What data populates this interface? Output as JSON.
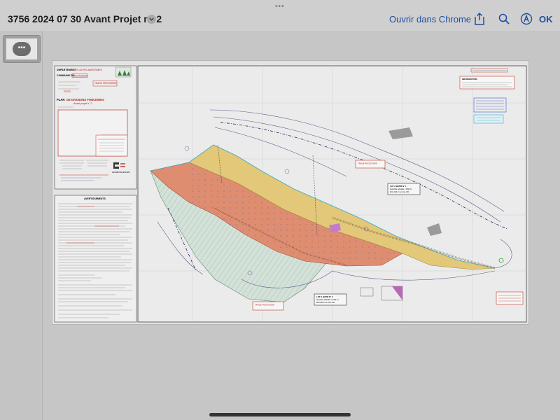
{
  "toolbar": {
    "title": "3756 2024 07 30 Avant Projet n° 2",
    "open_in_chrome": "Ouvrir dans Chrome",
    "ok": "OK",
    "grabber": "•••",
    "icons": [
      "chevron-down-icon",
      "share-icon",
      "search-icon",
      "markup-icon"
    ]
  },
  "sidebar": {
    "thumb_more": "•••"
  },
  "document": {
    "cartouche": {
      "dept_label": "DEPARTEMENT",
      "dept_value": "DES ALPES-MARITIMES",
      "commune_label": "COMMUNE DE",
      "commune_value": "BELVEDERE",
      "stamp": "TRAGE PROVISOIRE",
      "plan_label": "PLAN",
      "plan_title": "DE DIVISIONS FONCIERES",
      "plan_subtitle": "Avant projet n° 2",
      "firm": "GEOMETRE-EXPERT",
      "notice_title": "AVERTISSEMENTS"
    },
    "map": {
      "stamp_top": "TRAGE PROVISOIRE",
      "stamp_bottom": "TRAGE PROVISOIRE",
      "info_title": "INFORMATION :",
      "lot1_title": "LOT A BATIR N° 1",
      "lot1_area": "Superficie indicative = 1991 m²",
      "lot1_zone": "Dont 1114 m² en zone UF1",
      "lot2_title": "LOT A BATIR N° 2",
      "lot2_area": "Superficie indicative = 1912 m²",
      "lot2_zone": "Dont 863 m² en zone UF1"
    }
  },
  "colors": {
    "lot_yellow": "#e2c878",
    "lot_orange": "#df8f72",
    "green_hatch": "#cfe0d6",
    "accent_blue": "#1f4fa0",
    "stamp_red": "#c0392b"
  }
}
